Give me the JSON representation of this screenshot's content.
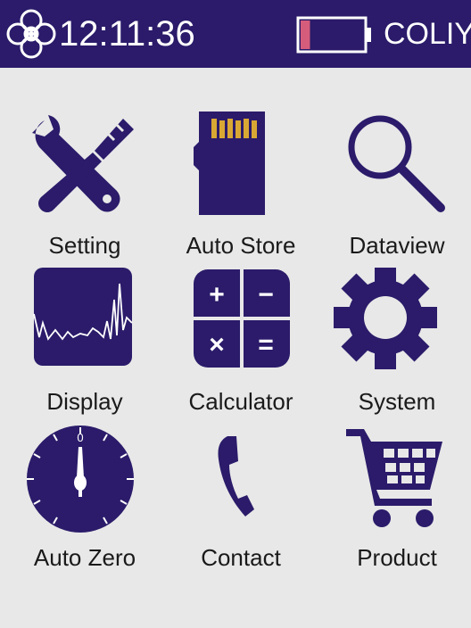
{
  "status_bar": {
    "time": "12:11:36",
    "brand": "COLIY",
    "battery_level": 0.15,
    "battery_color": "#d65c7b",
    "bar_color": "#2b1b6a"
  },
  "menu": {
    "items": [
      {
        "label": "Setting",
        "icon": "tools-icon"
      },
      {
        "label": "Auto Store",
        "icon": "sd-card-icon"
      },
      {
        "label": "Dataview",
        "icon": "magnifier-icon"
      },
      {
        "label": "Display",
        "icon": "waveform-icon"
      },
      {
        "label": "Calculator",
        "icon": "calculator-icon"
      },
      {
        "label": "System",
        "icon": "gear-icon"
      },
      {
        "label": "Auto Zero",
        "icon": "dial-icon"
      },
      {
        "label": "Contact",
        "icon": "phone-icon"
      },
      {
        "label": "Product",
        "icon": "cart-icon"
      }
    ]
  },
  "calculator_symbols": [
    "+",
    "−",
    "×",
    "="
  ],
  "dial_mark": "0",
  "theme": {
    "primary": "#2b1b6a",
    "background": "#e8e8e8"
  }
}
